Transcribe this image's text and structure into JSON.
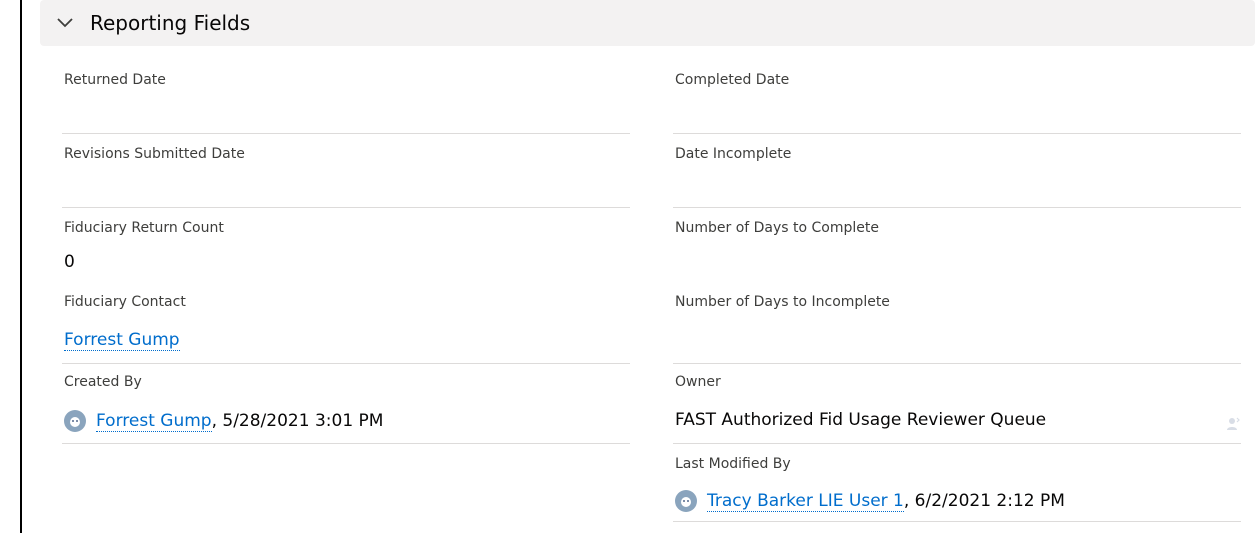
{
  "section": {
    "title": "Reporting Fields",
    "icon": "chevron-down-icon"
  },
  "left": {
    "returned_date": {
      "label": "Returned Date",
      "value": ""
    },
    "revisions_submitted_date": {
      "label": "Revisions Submitted Date",
      "value": ""
    },
    "fiduciary_return_count": {
      "label": "Fiduciary Return Count",
      "value": "0"
    },
    "fiduciary_contact": {
      "label": "Fiduciary Contact",
      "value": "Forrest Gump"
    },
    "created_by": {
      "label": "Created By",
      "user": "Forrest Gump",
      "timestamp": ", 5/28/2021 3:01 PM"
    }
  },
  "right": {
    "completed_date": {
      "label": "Completed Date",
      "value": ""
    },
    "date_incomplete": {
      "label": "Date Incomplete",
      "value": ""
    },
    "days_to_complete": {
      "label": "Number of Days to Complete",
      "value": ""
    },
    "days_to_incomplete": {
      "label": "Number of Days to Incomplete",
      "value": ""
    },
    "owner": {
      "label": "Owner",
      "value": "FAST Authorized Fid Usage Reviewer Queue"
    },
    "last_modified_by": {
      "label": "Last Modified By",
      "user": "Tracy Barker LIE User 1",
      "timestamp": ", 6/2/2021 2:12 PM"
    }
  },
  "colors": {
    "link": "#006dcc",
    "header_bg": "#f3f2f2",
    "divider": "#dddbda"
  }
}
